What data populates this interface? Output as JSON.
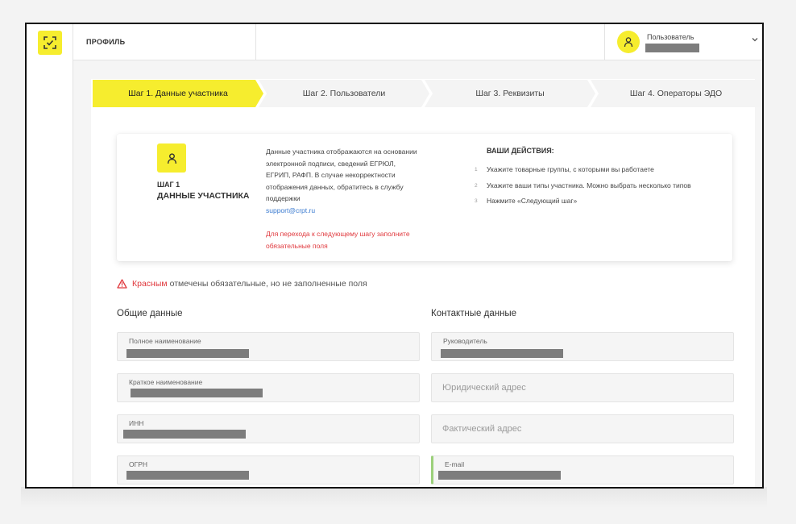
{
  "header": {
    "title": "ПРОФИЛЬ",
    "user_label": "Пользователь"
  },
  "steps": [
    {
      "label": "Шаг 1. Данные участника"
    },
    {
      "label": "Шаг 2. Пользователи"
    },
    {
      "label": "Шаг 3. Реквизиты"
    },
    {
      "label": "Шаг 4. Операторы ЭДО"
    }
  ],
  "card": {
    "step_num": "ШАГ 1",
    "step_title": "ДАННЫЕ УЧАСТНИКА",
    "info": "Данные участника отображаются на основании электронной подписи, сведений ЕГРЮЛ, ЕГРИП, РАФП. В случае некорректности отображения данных, обратитесь в службу поддержки",
    "support_email": "support@crpt.ru",
    "next_warning": "Для перехода к следующему шагу заполните обязательные поля",
    "actions_title": "ВАШИ ДЕЙСТВИЯ:",
    "actions": [
      {
        "num": "1",
        "text": "Укажите товарные группы, с которыми вы работаете"
      },
      {
        "num": "2",
        "text": "Укажите ваши типы участника. Можно выбрать несколько типов"
      },
      {
        "num": "3",
        "text": "Нажмите «Следующий шаг»"
      }
    ]
  },
  "notice": {
    "red_word": "Красным",
    "rest": "отмечены обязательные, но не заполненные поля"
  },
  "general": {
    "title": "Общие данные",
    "full_name_label": "Полное наименование",
    "short_name_label": "Краткое наименование",
    "inn_label": "ИНН",
    "ogrn_label": "ОГРН"
  },
  "contacts": {
    "title": "Контактные данные",
    "head_label": "Руководитель",
    "legal_address_placeholder": "Юридический адрес",
    "actual_address_placeholder": "Фактический адрес",
    "email_label": "E-mail"
  },
  "colors": {
    "accent": "#f6ed2e",
    "error": "#e0393e",
    "link": "#3b7bd0"
  }
}
